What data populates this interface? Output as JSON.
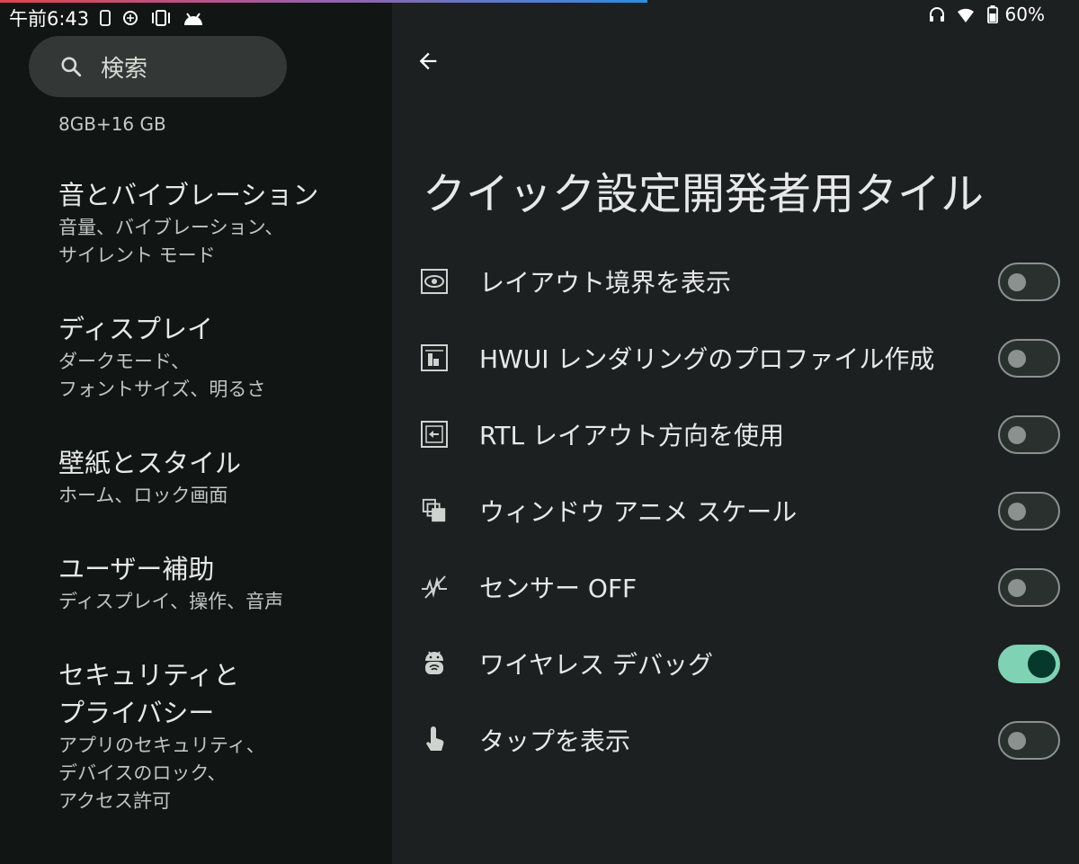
{
  "status_bar": {
    "time": "午前6:43",
    "battery": "60%"
  },
  "left_panel": {
    "search": {
      "placeholder": "検索"
    },
    "storage_summary": "8GB+16 GB",
    "items": [
      {
        "title": "音とバイブレーション",
        "subtitle": [
          "音量、バイブレーション、",
          "サイレント モード"
        ]
      },
      {
        "title": "ディスプレイ",
        "subtitle": [
          "ダークモード、",
          "フォントサイズ、明るさ"
        ]
      },
      {
        "title": "壁紙とスタイル",
        "subtitle": [
          "ホーム、ロック画面"
        ]
      },
      {
        "title": "ユーザー補助",
        "subtitle": [
          "ディスプレイ、操作、音声"
        ]
      },
      {
        "title": [
          "セキュリティと",
          "プライバシー"
        ],
        "subtitle": [
          "アプリのセキュリティ、",
          "デバイスのロック、",
          "アクセス許可"
        ]
      }
    ]
  },
  "right_panel": {
    "title": "クイック設定開発者用タイル",
    "tiles": [
      {
        "label": "レイアウト境界を表示",
        "icon": "layout-bounds-icon",
        "enabled": false
      },
      {
        "label": "HWUI レンダリングのプロファイル作成",
        "icon": "gpu-profile-icon",
        "enabled": false
      },
      {
        "label": "RTL レイアウト方向を使用",
        "icon": "rtl-layout-icon",
        "enabled": false
      },
      {
        "label": "ウィンドウ アニメ スケール",
        "icon": "window-animation-icon",
        "enabled": false
      },
      {
        "label": "センサー OFF",
        "icon": "sensors-off-icon",
        "enabled": false
      },
      {
        "label": "ワイヤレス デバッグ",
        "icon": "android-debug-icon",
        "enabled": true
      },
      {
        "label": "タップを表示",
        "icon": "touch-icon",
        "enabled": false
      }
    ]
  },
  "colors": {
    "left_bg": "#111514",
    "right_bg": "#1c2020",
    "toggle_on": "#7fd2b4",
    "toggle_on_knob": "#07382c",
    "toggle_off_border": "#8b918e"
  }
}
